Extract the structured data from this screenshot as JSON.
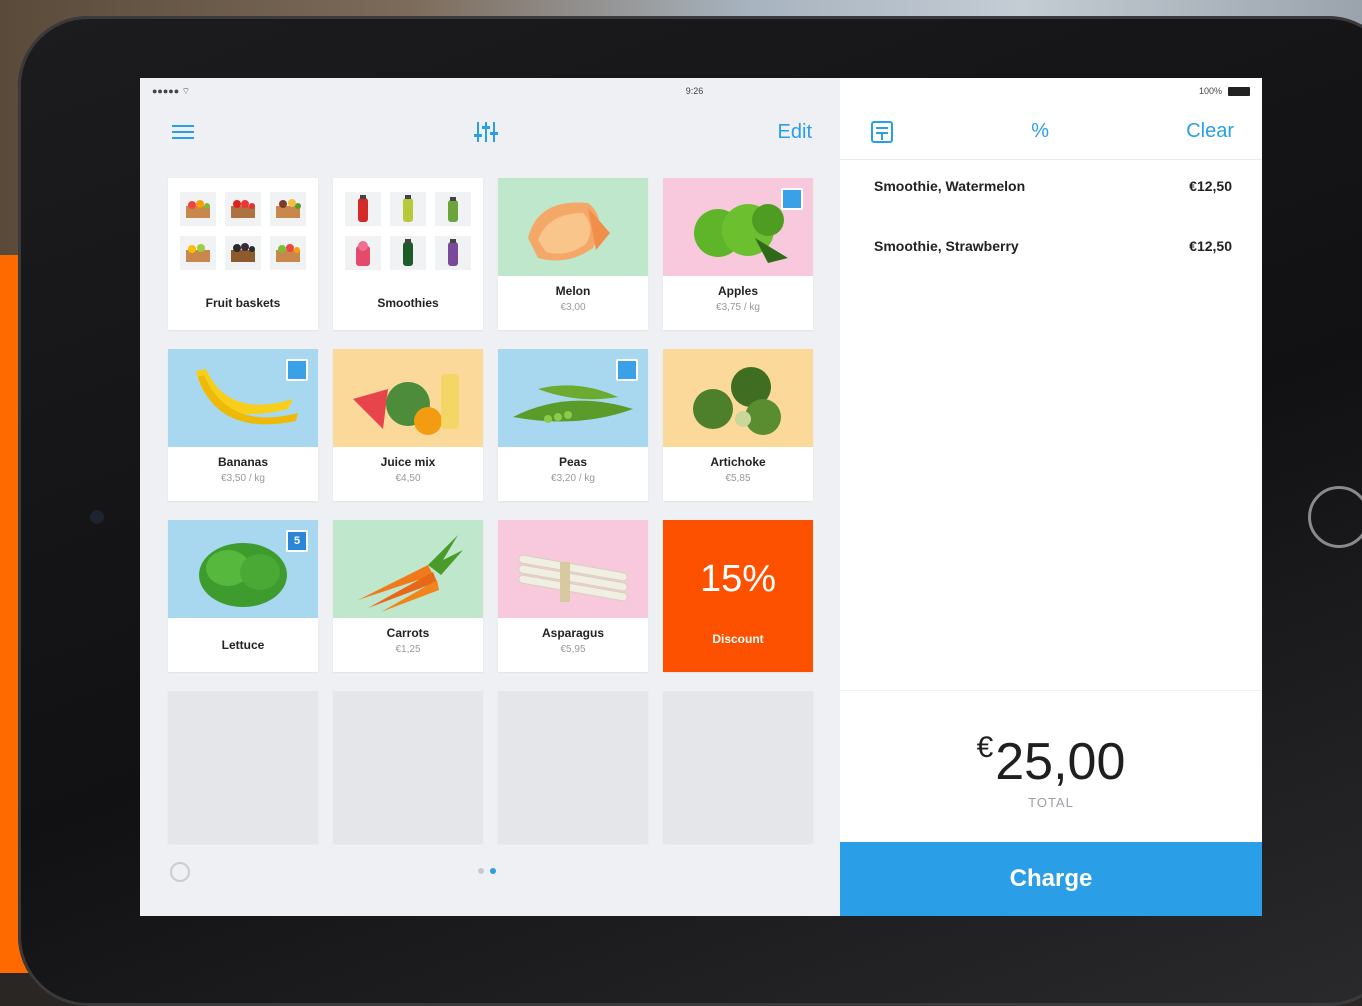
{
  "colors": {
    "accent": "#2a9fe8",
    "discount": "#fd5100",
    "background_orange": "#ff6a00"
  },
  "status_bar": {
    "time": "9:26",
    "battery": "100%"
  },
  "left_toolbar": {
    "menu_icon": "hamburger-menu-icon",
    "sliders_icon": "sliders-icon",
    "edit_label": "Edit"
  },
  "right_toolbar": {
    "receipt_icon": "receipt-icon",
    "percent_label": "%",
    "clear_label": "Clear"
  },
  "tiles": [
    {
      "name": "Fruit baskets",
      "type": "folder"
    },
    {
      "name": "Smoothies",
      "type": "folder"
    },
    {
      "name": "Melon",
      "price": "€3,00",
      "color": "#bfe7cc"
    },
    {
      "name": "Apples",
      "price": "€3,75 / kg",
      "color": "#f8c9dc",
      "badge": true
    },
    {
      "name": "Bananas",
      "price": "€3,50 / kg",
      "color": "#a8d8f0",
      "badge": true
    },
    {
      "name": "Juice mix",
      "price": "€4,50",
      "color": "#fbd99a"
    },
    {
      "name": "Peas",
      "price": "€3,20 / kg",
      "color": "#a8d8f0",
      "badge": true
    },
    {
      "name": "Artichoke",
      "price": "€5,85",
      "color": "#fbd99a"
    },
    {
      "name": "Lettuce",
      "color": "#a8d8f0",
      "badge_text": "5"
    },
    {
      "name": "Carrots",
      "price": "€1,25",
      "color": "#bfe7cc"
    },
    {
      "name": "Asparagus",
      "price": "€5,95",
      "color": "#f8c9dc"
    }
  ],
  "discount_tile": {
    "value": "15%",
    "label": "Discount"
  },
  "order": [
    {
      "item": "Smoothie, Watermelon",
      "price": "€12,50"
    },
    {
      "item": "Smoothie, Strawberry",
      "price": "€12,50"
    }
  ],
  "total": {
    "currency": "€",
    "amount": "25,00",
    "label": "TOTAL"
  },
  "charge_label": "Charge"
}
